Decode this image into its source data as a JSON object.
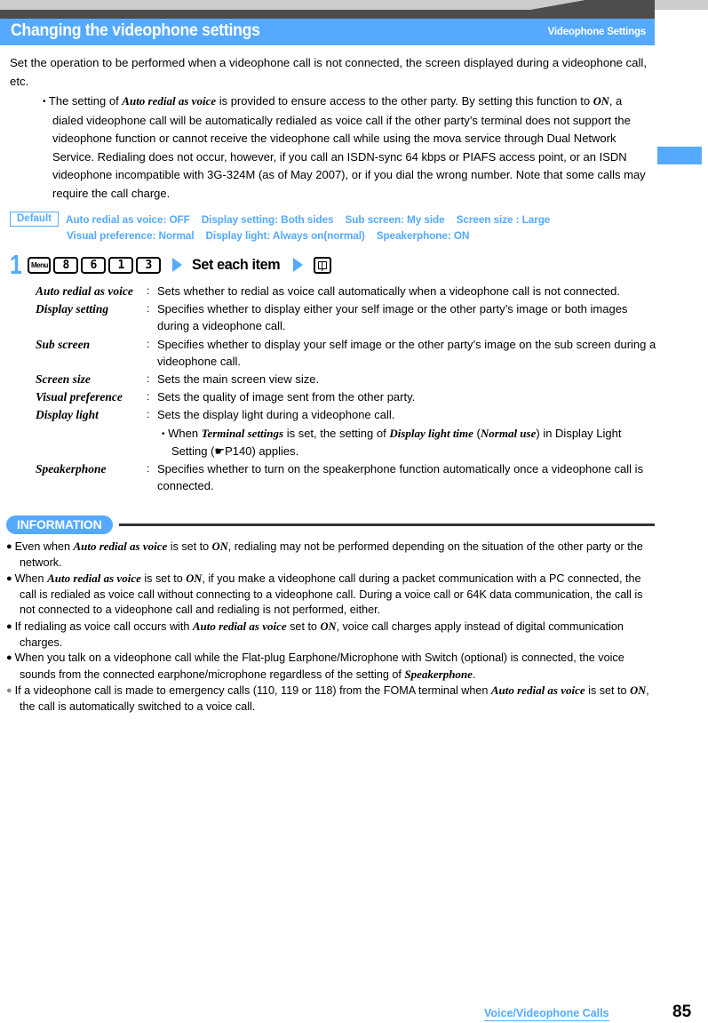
{
  "header": {
    "title": "Changing the videophone settings",
    "subtitle": "Videophone Settings"
  },
  "intro": "Set the operation to be performed when a videophone call is not connected, the screen displayed during a videophone call, etc.",
  "bullet_note": {
    "marker": "•",
    "part1": "The setting of ",
    "em1": "Auto redial as voice",
    "part2": " is provided to ensure access to the other party. By setting this function to ",
    "em2": "ON",
    "part3": ", a dialed videophone call will be automatically redialed as voice call if the other party’s terminal does not support the videophone function or cannot receive the videophone call while using the mova service through Dual Network Service. Redialing does not occur, however, if you call an ISDN-sync 64 kbps or PIAFS access point, or an ISDN videophone incompatible with 3G-324M (as of May 2007), or if you dial the wrong number. Note that some calls may require the call charge."
  },
  "defaults": {
    "tag": "Default",
    "line1": [
      "Auto redial as voice: OFF",
      "Display setting: Both sides",
      "Sub screen: My side",
      "Screen size : Large"
    ],
    "line2": [
      "Visual preference: Normal",
      "Display light: Always on(normal)",
      "Speakerphone: ON"
    ]
  },
  "step": {
    "number": "1",
    "keys": [
      "Menu",
      "8",
      "6",
      "1",
      "3"
    ],
    "label": "Set each item",
    "end_key_icon": "book-key-icon"
  },
  "definitions": [
    {
      "term": "Auto redial as voice",
      "colon": ":",
      "desc": "Sets whether to redial as voice call automatically when a videophone call is not connected."
    },
    {
      "term": "Display setting",
      "colon": ":",
      "desc": "Specifies whether to display either your self image or the other party’s image or both images during a videophone call."
    },
    {
      "term": "Sub screen",
      "colon": ":",
      "desc": "Specifies whether to display your self image or the other party’s image on the sub screen during a videophone call."
    },
    {
      "term": "Screen size",
      "colon": ":",
      "desc": "Sets the main screen view size."
    },
    {
      "term": "Visual preference",
      "colon": ":",
      "desc": "Sets the quality of image sent from the other party."
    },
    {
      "term": "Display light",
      "colon": ":",
      "desc": "Sets the display light during a videophone call."
    },
    {
      "term": "Speakerphone",
      "colon": ":",
      "desc": "Specifies whether to turn on the speakerphone function automatically once a videophone call is connected."
    }
  ],
  "display_light_sub": {
    "marker": "•",
    "p1": "When ",
    "em1": "Terminal settings",
    "p2": " is set, the setting of ",
    "em2": "Display light time",
    "p3": " (",
    "em3": "Normal use",
    "p4": ") in Display Light Setting (",
    "ref_icon": "☛",
    "ref": "P140",
    "p5": ") applies."
  },
  "information": {
    "badge": "INFORMATION",
    "items": [
      {
        "bullet": "●",
        "bullet_color": "#000000",
        "p1": "Even when ",
        "em1": "Auto redial as voice",
        "p2": " is set to ",
        "em2": "ON",
        "p3": ", redialing may not be performed depending on the situation of the other party or the network."
      },
      {
        "bullet": "●",
        "bullet_color": "#000000",
        "p1": "When ",
        "em1": "Auto redial as voice",
        "p2": " is set to ",
        "em2": "ON",
        "p3": ", if you make a videophone call during a packet communication with a PC connected, the call is redialed as voice call without connecting to a videophone call. During a voice call or 64K data communication, the call is not connected to a videophone call and redialing is not performed, either."
      },
      {
        "bullet": "●",
        "bullet_color": "#000000",
        "p1": "If redialing as voice call occurs with ",
        "em1": "Auto redial as voice",
        "p2": " set to ",
        "em2": "ON",
        "p3": ", voice call charges apply instead of digital communication charges."
      },
      {
        "bullet": "●",
        "bullet_color": "#000000",
        "p1": "When you talk on a videophone call while the Flat-plug Earphone/Microphone with Switch (optional) is connected, the voice sounds from the connected earphone/microphone regardless of the setting of ",
        "em1": "Speakerphone",
        "p2": ".",
        "em2": "",
        "p3": ""
      },
      {
        "bullet": "●",
        "bullet_color": "#8c8c8c",
        "p1": "If a videophone call is made to emergency calls (110, 119 or 118) from the FOMA terminal when ",
        "em1": "Auto redial as voice",
        "p2": " is set to ",
        "em2": "ON",
        "p3": ", the call is automatically switched to a voice call."
      }
    ]
  },
  "footer": {
    "label": "Voice/Videophone Calls",
    "page": "85"
  },
  "colors": {
    "accent_blue": "#55aaff",
    "bar_light_grey": "#cccccc",
    "bar_dark_grey": "#4d4d4d",
    "rule_dark": "#333333",
    "grey_bullet": "#8c8c8c"
  }
}
